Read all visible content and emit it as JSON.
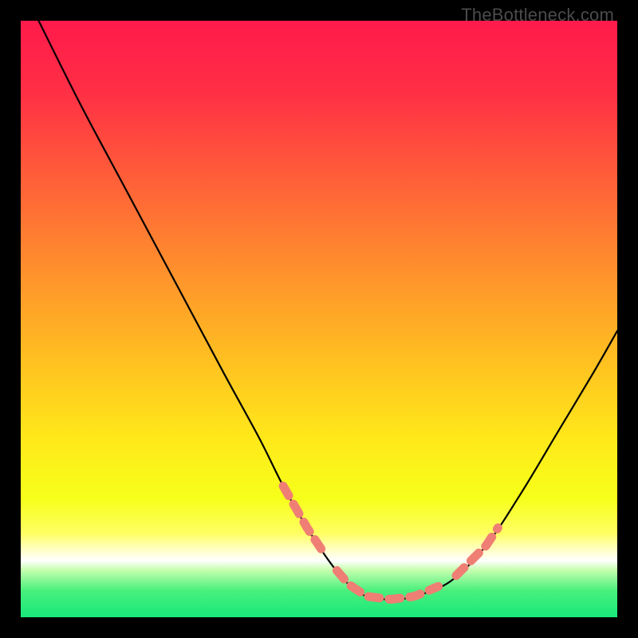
{
  "watermark": "TheBottleneck.com",
  "gradient": {
    "stops": [
      {
        "offset": 0.0,
        "color": "#ff1a4b"
      },
      {
        "offset": 0.12,
        "color": "#ff2f45"
      },
      {
        "offset": 0.25,
        "color": "#ff5a3a"
      },
      {
        "offset": 0.4,
        "color": "#ff8a2e"
      },
      {
        "offset": 0.55,
        "color": "#ffba22"
      },
      {
        "offset": 0.7,
        "color": "#ffe81a"
      },
      {
        "offset": 0.8,
        "color": "#f6ff1a"
      },
      {
        "offset": 0.86,
        "color": "#ffff63"
      },
      {
        "offset": 0.88,
        "color": "#ffffb0"
      },
      {
        "offset": 0.905,
        "color": "#ffffff"
      },
      {
        "offset": 0.92,
        "color": "#c9ffb0"
      },
      {
        "offset": 0.955,
        "color": "#49f07c"
      },
      {
        "offset": 1.0,
        "color": "#17e87a"
      }
    ]
  },
  "chart_data": {
    "type": "line",
    "title": "",
    "xlabel": "",
    "ylabel": "",
    "xlim": [
      0,
      100
    ],
    "ylim": [
      0,
      100
    ],
    "series": [
      {
        "name": "bottleneck-curve",
        "x": [
          3,
          10,
          18,
          26,
          34,
          40,
          44,
          48,
          52,
          55,
          58,
          62,
          66,
          72,
          78,
          84,
          90,
          96,
          100
        ],
        "y": [
          100,
          86,
          71,
          56,
          41,
          30,
          22,
          15,
          9,
          5.5,
          3.5,
          3,
          3.5,
          6,
          12,
          21,
          31,
          41,
          48
        ]
      }
    ],
    "salmon_dash_ranges": [
      {
        "from_x": 44,
        "to_x": 51
      },
      {
        "from_x": 53,
        "to_x": 70
      },
      {
        "from_x": 73,
        "to_x": 80
      }
    ]
  }
}
